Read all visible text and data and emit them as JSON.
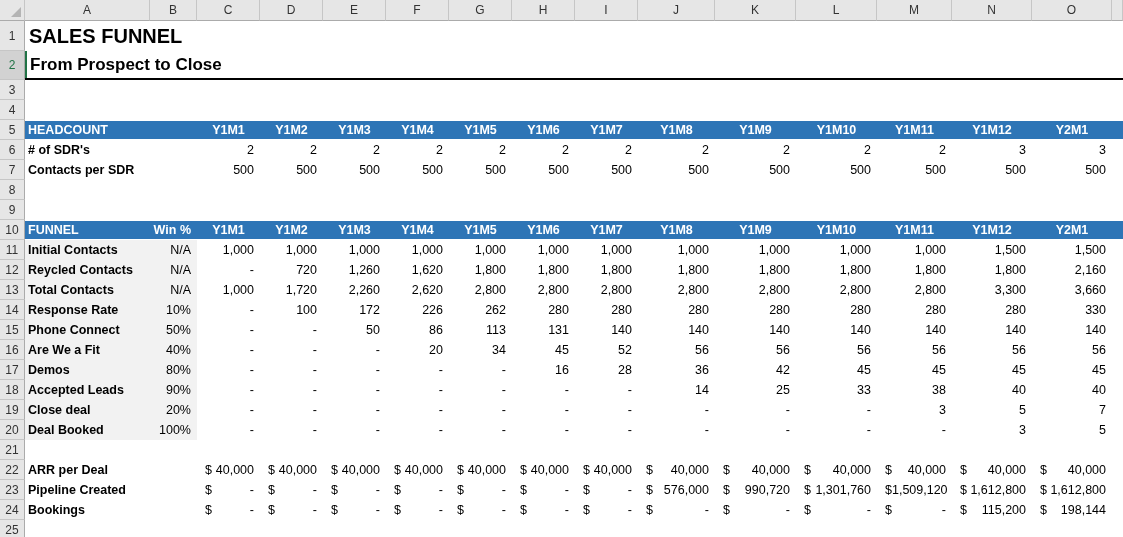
{
  "columns": [
    "A",
    "B",
    "C",
    "D",
    "E",
    "F",
    "G",
    "H",
    "I",
    "J",
    "K",
    "L",
    "M",
    "N",
    "O"
  ],
  "rows": [
    {
      "number": "1",
      "selected": false,
      "kind": "title",
      "text": "SALES FUNNEL"
    },
    {
      "number": "2",
      "selected": true,
      "kind": "subtitle",
      "text": "From Prospect to Close"
    },
    {
      "number": "3",
      "selected": false,
      "kind": "blank"
    },
    {
      "number": "4",
      "selected": false,
      "kind": "blank"
    },
    {
      "number": "5",
      "selected": false,
      "kind": "header",
      "label": "HEADCOUNT",
      "periods": [
        "Y1M1",
        "Y1M2",
        "Y1M3",
        "Y1M4",
        "Y1M5",
        "Y1M6",
        "Y1M7",
        "Y1M8",
        "Y1M9",
        "Y1M10",
        "Y1M11",
        "Y1M12",
        "Y2M1"
      ]
    },
    {
      "number": "6",
      "selected": false,
      "kind": "data",
      "shaded": false,
      "label": "# of SDR's",
      "values": [
        "2",
        "2",
        "2",
        "2",
        "2",
        "2",
        "2",
        "2",
        "2",
        "2",
        "2",
        "3",
        "3"
      ]
    },
    {
      "number": "7",
      "selected": false,
      "kind": "data",
      "shaded": false,
      "label": "Contacts per SDR",
      "values": [
        "500",
        "500",
        "500",
        "500",
        "500",
        "500",
        "500",
        "500",
        "500",
        "500",
        "500",
        "500",
        "500"
      ]
    },
    {
      "number": "8",
      "selected": false,
      "kind": "blank"
    },
    {
      "number": "9",
      "selected": false,
      "kind": "blank"
    },
    {
      "number": "10",
      "selected": false,
      "kind": "header",
      "label": "FUNNEL",
      "rate": "Win %",
      "periods": [
        "Y1M1",
        "Y1M2",
        "Y1M3",
        "Y1M4",
        "Y1M5",
        "Y1M6",
        "Y1M7",
        "Y1M8",
        "Y1M9",
        "Y1M10",
        "Y1M11",
        "Y1M12",
        "Y2M1"
      ]
    },
    {
      "number": "11",
      "selected": false,
      "kind": "data",
      "shaded": true,
      "label": "Initial Contacts",
      "rate": "N/A",
      "values": [
        "1,000",
        "1,000",
        "1,000",
        "1,000",
        "1,000",
        "1,000",
        "1,000",
        "1,000",
        "1,000",
        "1,000",
        "1,000",
        "1,500",
        "1,500"
      ]
    },
    {
      "number": "12",
      "selected": false,
      "kind": "data",
      "shaded": true,
      "label": "Reycled Contacts",
      "rate": "N/A",
      "values": [
        "-",
        "720",
        "1,260",
        "1,620",
        "1,800",
        "1,800",
        "1,800",
        "1,800",
        "1,800",
        "1,800",
        "1,800",
        "1,800",
        "2,160"
      ]
    },
    {
      "number": "13",
      "selected": false,
      "kind": "data",
      "shaded": true,
      "label": "Total Contacts",
      "rate": "N/A",
      "values": [
        "1,000",
        "1,720",
        "2,260",
        "2,620",
        "2,800",
        "2,800",
        "2,800",
        "2,800",
        "2,800",
        "2,800",
        "2,800",
        "3,300",
        "3,660"
      ]
    },
    {
      "number": "14",
      "selected": false,
      "kind": "data",
      "shaded": true,
      "label": "Response Rate",
      "rate": "10%",
      "values": [
        "-",
        "100",
        "172",
        "226",
        "262",
        "280",
        "280",
        "280",
        "280",
        "280",
        "280",
        "280",
        "330"
      ]
    },
    {
      "number": "15",
      "selected": false,
      "kind": "data",
      "shaded": true,
      "label": "Phone Connect",
      "rate": "50%",
      "values": [
        "-",
        "-",
        "50",
        "86",
        "113",
        "131",
        "140",
        "140",
        "140",
        "140",
        "140",
        "140",
        "140"
      ]
    },
    {
      "number": "16",
      "selected": false,
      "kind": "data",
      "shaded": true,
      "label": "Are We a Fit",
      "rate": "40%",
      "values": [
        "-",
        "-",
        "-",
        "20",
        "34",
        "45",
        "52",
        "56",
        "56",
        "56",
        "56",
        "56",
        "56"
      ]
    },
    {
      "number": "17",
      "selected": false,
      "kind": "data",
      "shaded": true,
      "label": "Demos",
      "rate": "80%",
      "values": [
        "-",
        "-",
        "-",
        "-",
        "-",
        "16",
        "28",
        "36",
        "42",
        "45",
        "45",
        "45",
        "45"
      ]
    },
    {
      "number": "18",
      "selected": false,
      "kind": "data",
      "shaded": true,
      "label": "Accepted Leads",
      "rate": "90%",
      "values": [
        "-",
        "-",
        "-",
        "-",
        "-",
        "-",
        "-",
        "14",
        "25",
        "33",
        "38",
        "40",
        "40"
      ]
    },
    {
      "number": "19",
      "selected": false,
      "kind": "data",
      "shaded": true,
      "label": "Close deal",
      "rate": "20%",
      "values": [
        "-",
        "-",
        "-",
        "-",
        "-",
        "-",
        "-",
        "-",
        "-",
        "-",
        "3",
        "5",
        "7"
      ]
    },
    {
      "number": "20",
      "selected": false,
      "kind": "data",
      "shaded": true,
      "label": "Deal Booked",
      "rate": "100%",
      "values": [
        "-",
        "-",
        "-",
        "-",
        "-",
        "-",
        "-",
        "-",
        "-",
        "-",
        "-",
        "3",
        "5"
      ]
    },
    {
      "number": "21",
      "selected": false,
      "kind": "blank"
    },
    {
      "number": "22",
      "selected": false,
      "kind": "money",
      "label": "ARR per Deal",
      "values": [
        {
          "symbol": "$",
          "amount": "40,000"
        },
        {
          "symbol": "$",
          "amount": "40,000"
        },
        {
          "symbol": "$",
          "amount": "40,000"
        },
        {
          "symbol": "$",
          "amount": "40,000"
        },
        {
          "symbol": "$",
          "amount": "40,000"
        },
        {
          "symbol": "$",
          "amount": "40,000"
        },
        {
          "symbol": "$",
          "amount": "40,000"
        },
        {
          "symbol": "$",
          "amount": "40,000"
        },
        {
          "symbol": "$",
          "amount": "40,000"
        },
        {
          "symbol": "$",
          "amount": "40,000"
        },
        {
          "symbol": "$",
          "amount": "40,000"
        },
        {
          "symbol": "$",
          "amount": "40,000"
        },
        {
          "symbol": "$",
          "amount": "40,000"
        }
      ]
    },
    {
      "number": "23",
      "selected": false,
      "kind": "money",
      "label": "Pipeline Created",
      "values": [
        {
          "symbol": "$",
          "amount": "-"
        },
        {
          "symbol": "$",
          "amount": "-"
        },
        {
          "symbol": "$",
          "amount": "-"
        },
        {
          "symbol": "$",
          "amount": "-"
        },
        {
          "symbol": "$",
          "amount": "-"
        },
        {
          "symbol": "$",
          "amount": "-"
        },
        {
          "symbol": "$",
          "amount": "-"
        },
        {
          "symbol": "$",
          "amount": "576,000"
        },
        {
          "symbol": "$",
          "amount": "990,720"
        },
        {
          "symbol": "$",
          "amount": "1,301,760"
        },
        {
          "symbol": "$",
          "amount": "1,509,120"
        },
        {
          "symbol": "$",
          "amount": "1,612,800"
        },
        {
          "symbol": "$",
          "amount": "1,612,800"
        }
      ]
    },
    {
      "number": "24",
      "selected": false,
      "kind": "money",
      "label": "Bookings",
      "values": [
        {
          "symbol": "$",
          "amount": "-"
        },
        {
          "symbol": "$",
          "amount": "-"
        },
        {
          "symbol": "$",
          "amount": "-"
        },
        {
          "symbol": "$",
          "amount": "-"
        },
        {
          "symbol": "$",
          "amount": "-"
        },
        {
          "symbol": "$",
          "amount": "-"
        },
        {
          "symbol": "$",
          "amount": "-"
        },
        {
          "symbol": "$",
          "amount": "-"
        },
        {
          "symbol": "$",
          "amount": "-"
        },
        {
          "symbol": "$",
          "amount": "-"
        },
        {
          "symbol": "$",
          "amount": "-"
        },
        {
          "symbol": "$",
          "amount": "115,200"
        },
        {
          "symbol": "$",
          "amount": "198,144"
        }
      ]
    },
    {
      "number": "25",
      "selected": false,
      "kind": "blank"
    }
  ]
}
